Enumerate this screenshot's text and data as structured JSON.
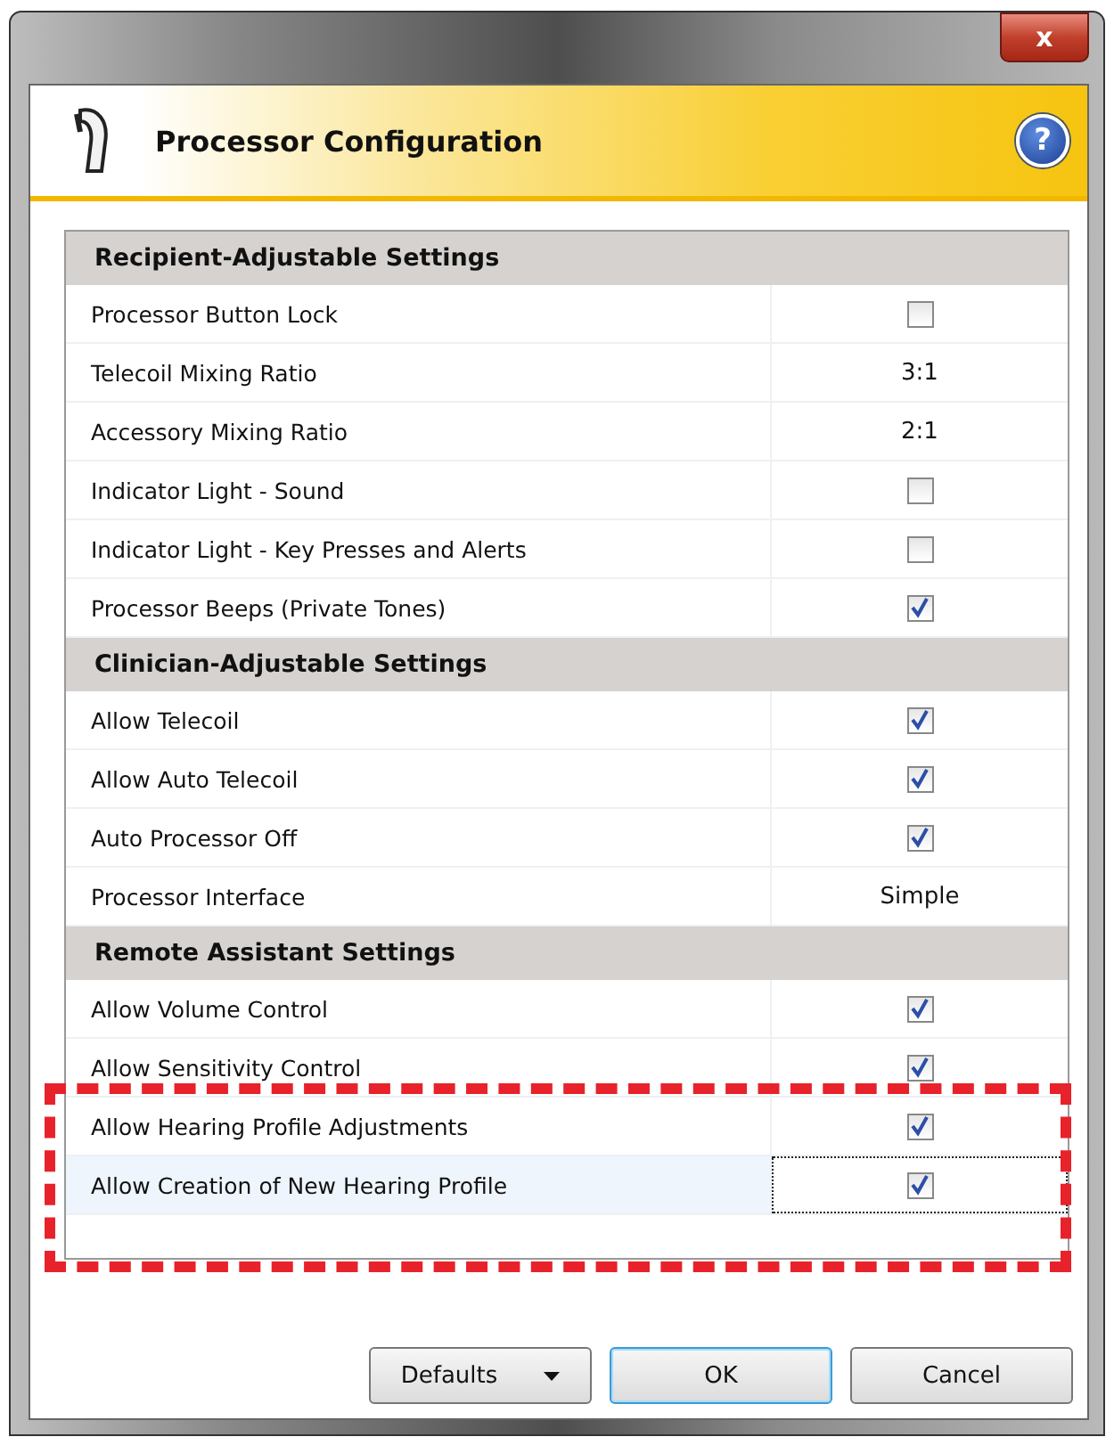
{
  "window": {
    "close": "x"
  },
  "header": {
    "title": "Processor Configuration",
    "help": "?"
  },
  "sections": [
    {
      "title": "Recipient-Adjustable Settings",
      "rows": [
        {
          "label": "Processor Button Lock",
          "kind": "checkbox",
          "checked": false,
          "selected": false
        },
        {
          "label": "Telecoil Mixing Ratio",
          "kind": "text",
          "value": "3:1",
          "selected": false
        },
        {
          "label": "Accessory Mixing Ratio",
          "kind": "text",
          "value": "2:1",
          "selected": false
        },
        {
          "label": "Indicator Light - Sound",
          "kind": "checkbox",
          "checked": false,
          "selected": false
        },
        {
          "label": "Indicator Light - Key Presses and Alerts",
          "kind": "checkbox",
          "checked": false,
          "selected": false
        },
        {
          "label": "Processor Beeps (Private Tones)",
          "kind": "checkbox",
          "checked": true,
          "selected": false
        }
      ]
    },
    {
      "title": "Clinician-Adjustable Settings",
      "rows": [
        {
          "label": "Allow Telecoil",
          "kind": "checkbox",
          "checked": true,
          "selected": false
        },
        {
          "label": "Allow Auto Telecoil",
          "kind": "checkbox",
          "checked": true,
          "selected": false
        },
        {
          "label": "Auto Processor Off",
          "kind": "checkbox",
          "checked": true,
          "selected": false
        },
        {
          "label": "Processor Interface",
          "kind": "text",
          "value": "Simple",
          "selected": false
        }
      ]
    },
    {
      "title": "Remote Assistant Settings",
      "rows": [
        {
          "label": "Allow Volume Control",
          "kind": "checkbox",
          "checked": true,
          "selected": false
        },
        {
          "label": "Allow Sensitivity Control",
          "kind": "checkbox",
          "checked": true,
          "selected": false
        }
      ],
      "highlighted_rows": [
        {
          "label": "Allow Hearing Profile Adjustments",
          "kind": "checkbox",
          "checked": true,
          "selected": false
        },
        {
          "label": "Allow Creation of New Hearing Profile",
          "kind": "checkbox",
          "checked": true,
          "selected": true
        }
      ]
    }
  ],
  "buttons": [
    {
      "label": "Defaults",
      "kind": "dropdown",
      "focused": false
    },
    {
      "label": "OK",
      "kind": "plain",
      "focused": true
    },
    {
      "label": "Cancel",
      "kind": "plain",
      "focused": false
    }
  ]
}
